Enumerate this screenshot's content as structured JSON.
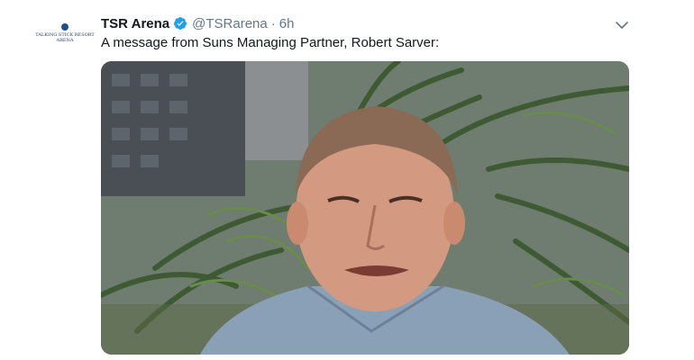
{
  "tweet": {
    "avatar_logo": {
      "line1": "TALKING STICK RESORT",
      "line2": "ARENA"
    },
    "display_name": "TSR Arena",
    "verified_icon": "verified-badge-icon",
    "handle": "@TSRarena",
    "separator": "·",
    "time": "6h",
    "caret_icon": "chevron-down-icon",
    "text": "A message from Suns Managing Partner, Robert Sarver:"
  },
  "colors": {
    "verified": "#1da1f2",
    "secondary_text": "#657786",
    "primary_text": "#14171a"
  }
}
